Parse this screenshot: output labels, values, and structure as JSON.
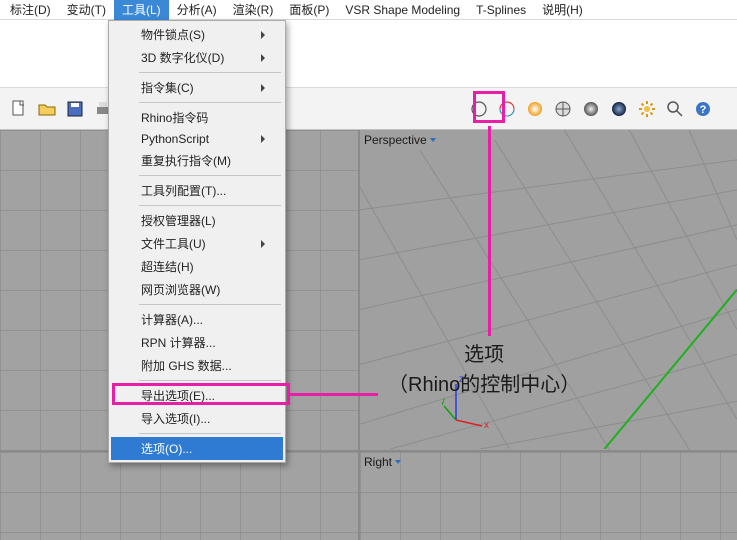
{
  "menubar": {
    "items": [
      {
        "label": "标注(D)"
      },
      {
        "label": "变动(T)"
      },
      {
        "label": "工具(L)",
        "active": true
      },
      {
        "label": "分析(A)"
      },
      {
        "label": "渲染(R)"
      },
      {
        "label": "面板(P)"
      },
      {
        "label": "VSR Shape Modeling"
      },
      {
        "label": "T-Splines"
      },
      {
        "label": "说明(H)"
      }
    ]
  },
  "dropdown": {
    "groups": [
      [
        {
          "label": "物件锁点(S)",
          "submenu": true
        },
        {
          "label": "3D 数字化仪(D)",
          "submenu": true
        }
      ],
      [
        {
          "label": "指令集(C)",
          "submenu": true
        }
      ],
      [
        {
          "label": "Rhino指令码"
        },
        {
          "label": "PythonScript",
          "submenu": true
        },
        {
          "label": "重复执行指令(M)"
        }
      ],
      [
        {
          "label": "工具列配置(T)..."
        }
      ],
      [
        {
          "label": "授权管理器(L)"
        },
        {
          "label": "文件工具(U)",
          "submenu": true
        },
        {
          "label": "超连结(H)"
        },
        {
          "label": "网页浏览器(W)"
        }
      ],
      [
        {
          "label": "计算器(A)..."
        },
        {
          "label": "RPN 计算器..."
        },
        {
          "label": "附加 GHS 数据..."
        }
      ],
      [
        {
          "label": "导出选项(E)..."
        },
        {
          "label": "导入选项(I)..."
        }
      ],
      [
        {
          "label": "选项(O)...",
          "highlight": true
        }
      ]
    ]
  },
  "viewports": {
    "top_right": "Perspective",
    "bottom_right": "Right"
  },
  "toolbar": {
    "icons": [
      "arrow-icon",
      "doc-icon",
      "folder-icon",
      "save-icon",
      "print-icon",
      "reticle-icon",
      "copy-icon",
      "paste-icon",
      "undo-icon",
      "redo-icon"
    ],
    "icons2": [
      "circle-plain-icon",
      "ring-rainbow-icon",
      "sphere-shade-icon",
      "sphere-wire-icon",
      "sphere-gray-icon",
      "sphere-blue-icon",
      "gear-icon",
      "magnify-icon",
      "help-icon"
    ]
  },
  "annotation": {
    "line1": "选项",
    "line2": "（Rhino的控制中心）"
  },
  "axis": {
    "x": "x",
    "y": "y",
    "z": "z"
  }
}
